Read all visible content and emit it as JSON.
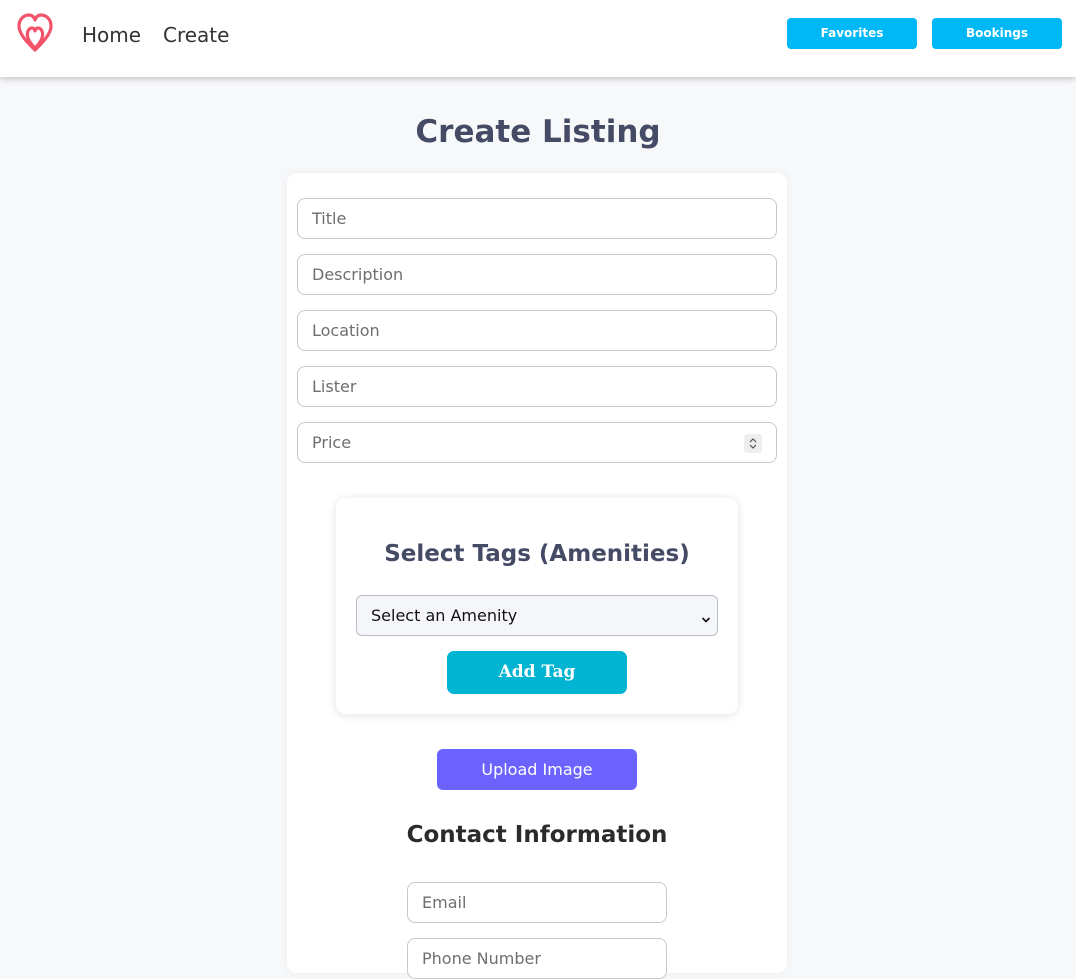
{
  "nav": {
    "links": [
      "Home",
      "Create"
    ],
    "buttons": [
      "Favorites",
      "Bookings"
    ],
    "logo_icon": "airbnb-logo-icon",
    "accent_color": "#00b8f5"
  },
  "page_title": "Create Listing",
  "form": {
    "title_placeholder": "Title",
    "description_placeholder": "Description",
    "location_placeholder": "Location",
    "lister_placeholder": "Lister",
    "price_placeholder": "Price"
  },
  "tags": {
    "heading": "Select Tags (Amenities)",
    "select_value": "Select an Amenity",
    "add_button": "Add Tag",
    "add_button_color": "#00b4d2"
  },
  "upload": {
    "label": "Upload Image",
    "color": "#6c63ff"
  },
  "contact": {
    "heading": "Contact Information",
    "email_placeholder": "Email",
    "phone_placeholder": "Phone Number"
  }
}
